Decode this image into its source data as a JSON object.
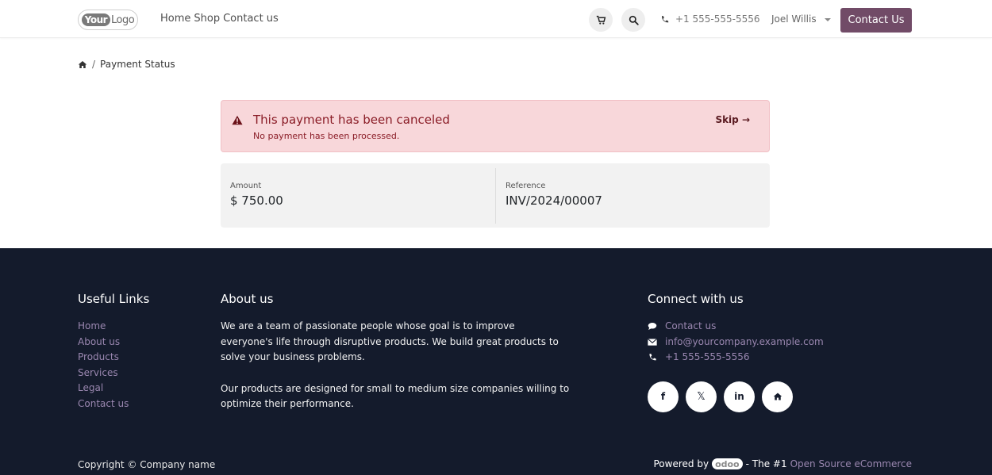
{
  "header": {
    "logo": {
      "your": "Your",
      "logo": "Logo"
    },
    "nav": [
      "Home",
      "Shop",
      "Contact us"
    ],
    "phone": "+1 555-555-5556",
    "user": "Joel Willis",
    "contact_button": "Contact Us"
  },
  "breadcrumb": {
    "current": "Payment Status",
    "separator": "/"
  },
  "alert": {
    "title": "This payment has been canceled",
    "subtitle": "No payment has been processed.",
    "skip": "Skip →",
    "color": "#f8d7da"
  },
  "payment": {
    "amount_label": "Amount",
    "amount": "$ 750.00",
    "reference_label": "Reference",
    "reference": "INV/2024/00007"
  },
  "footer": {
    "useful_links_title": "Useful Links",
    "useful_links": [
      "Home",
      "About us",
      "Products",
      "Services",
      "Legal",
      "Contact us"
    ],
    "about_title": "About us",
    "about_p1": "We are a team of passionate people whose goal is to improve everyone's life through disruptive products. We build great products to solve your business problems.",
    "about_p2": "Our products are designed for small to medium size companies willing to optimize their performance.",
    "connect_title": "Connect with us",
    "connect": {
      "contact": "Contact us",
      "email": "info@yourcompany.example.com",
      "phone": "+1 555-555-5556"
    },
    "socials": [
      "facebook-icon",
      "x-icon",
      "linkedin-icon",
      "home-icon"
    ],
    "social_labels": {
      "facebook": "f",
      "x": "𝕏",
      "linkedin": "in"
    },
    "copyright": "Copyright © Company name",
    "powered": {
      "prefix": "Powered by",
      "brand": "odoo",
      "middle": "- The #1",
      "link": "Open Source eCommerce"
    },
    "background": "#141b2c",
    "link_color": "#9a87b0"
  },
  "accent": "#714b67"
}
